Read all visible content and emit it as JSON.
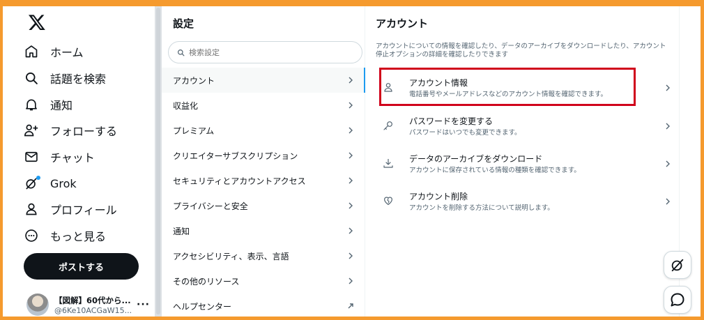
{
  "nav": {
    "items": [
      {
        "label": "ホーム",
        "icon": "home-icon"
      },
      {
        "label": "話題を検索",
        "icon": "search-icon"
      },
      {
        "label": "通知",
        "icon": "bell-icon"
      },
      {
        "label": "フォローする",
        "icon": "follow-icon"
      },
      {
        "label": "チャット",
        "icon": "mail-icon"
      },
      {
        "label": "Grok",
        "icon": "grok-icon"
      },
      {
        "label": "プロフィール",
        "icon": "profile-icon"
      },
      {
        "label": "もっと見る",
        "icon": "more-icon"
      }
    ],
    "post_label": "ポストする",
    "account_name": "【図解】60代から...",
    "account_handle": "@6Ke10ACGaW15...",
    "account_more": "···"
  },
  "settings": {
    "title": "設定",
    "search_placeholder": "検索設定",
    "items": [
      {
        "label": "アカウント",
        "arrow": "chevron"
      },
      {
        "label": "収益化",
        "arrow": "chevron"
      },
      {
        "label": "プレミアム",
        "arrow": "chevron"
      },
      {
        "label": "クリエイターサブスクリプション",
        "arrow": "chevron"
      },
      {
        "label": "セキュリティとアカウントアクセス",
        "arrow": "chevron"
      },
      {
        "label": "プライバシーと安全",
        "arrow": "chevron"
      },
      {
        "label": "通知",
        "arrow": "chevron"
      },
      {
        "label": "アクセシビリティ、表示、言語",
        "arrow": "chevron"
      },
      {
        "label": "その他のリソース",
        "arrow": "chevron"
      },
      {
        "label": "ヘルプセンター",
        "arrow": "external"
      }
    ]
  },
  "account": {
    "title": "アカウント",
    "description": "アカウントについての情報を確認したり、データのアーカイブをダウンロードしたり、アカウント停止オプションの詳細を確認したりできます",
    "items": [
      {
        "title": "アカウント情報",
        "subtitle": "電話番号やメールアドレスなどのアカウント情報を確認できます。",
        "icon": "user-icon"
      },
      {
        "title": "パスワードを変更する",
        "subtitle": "パスワードはいつでも変更できます。",
        "icon": "key-icon"
      },
      {
        "title": "データのアーカイブをダウンロード",
        "subtitle": "アカウントに保存されている情報の種類を確認できます。",
        "icon": "download-icon"
      },
      {
        "title": "アカウント削除",
        "subtitle": "アカウントを削除する方法について説明します。",
        "icon": "broken-heart-icon"
      }
    ]
  },
  "colors": {
    "accent": "#1d9bf0",
    "highlight": "#d0021b",
    "frame": "#f59a2e"
  }
}
